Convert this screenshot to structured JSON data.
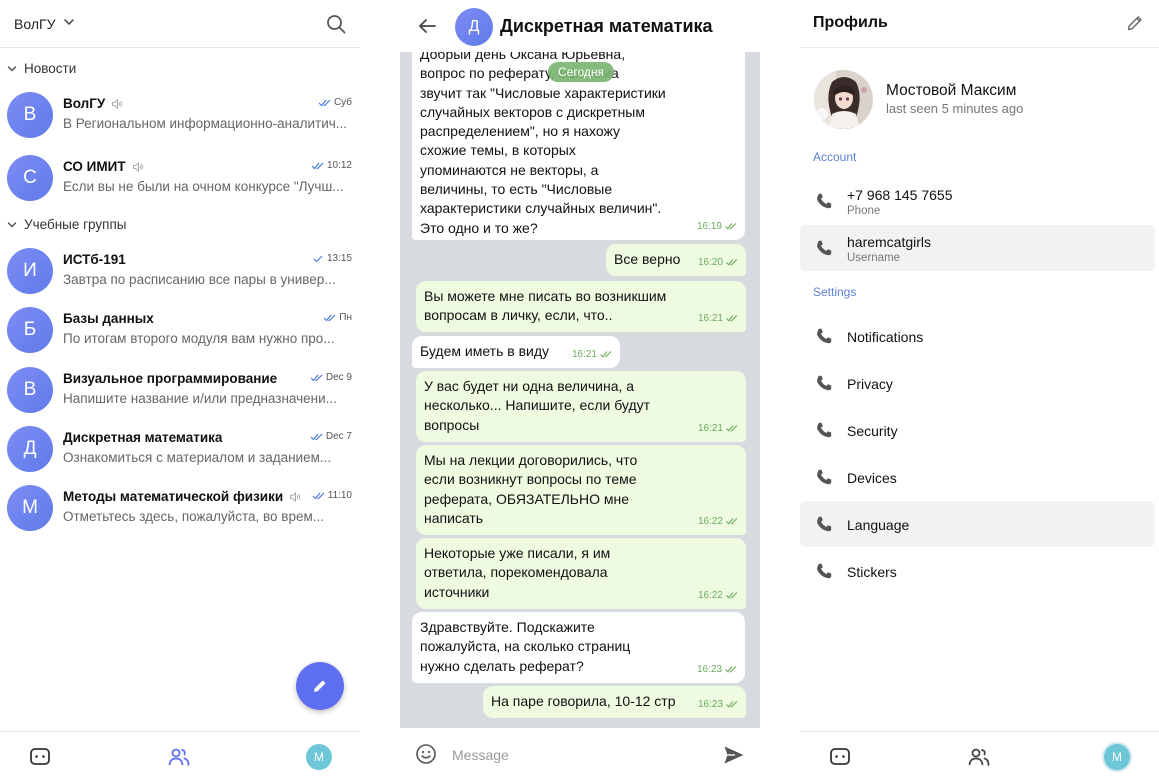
{
  "left": {
    "org_title": "ВолГУ",
    "sections": [
      {
        "label": "Новости"
      },
      {
        "label": "Учебные группы"
      }
    ],
    "chats": [
      {
        "initial": "В",
        "name": "ВолГУ",
        "muted": true,
        "time": "Суб",
        "preview": "В Региональном информационно-аналитич..."
      },
      {
        "initial": "С",
        "name": "СО ИМИТ",
        "muted": true,
        "time": "10:12",
        "preview": "Если вы не были на очном конкурсе \"Лучш..."
      },
      {
        "initial": "И",
        "name": "ИСТб-191",
        "muted": false,
        "time": "13:15",
        "preview": "Завтра по расписанию все пары в универ..."
      },
      {
        "initial": "Б",
        "name": "Базы данных",
        "muted": false,
        "time": "Пн",
        "preview": "По итогам второго модуля вам нужно про..."
      },
      {
        "initial": "В",
        "name": "Визуальное программирование",
        "muted": false,
        "time": "Dec 9",
        "preview": "Напишите название и/или предназначени..."
      },
      {
        "initial": "Д",
        "name": "Дискретная математика",
        "muted": false,
        "time": "Dec 7",
        "preview": "Ознакомиться с материалом и заданием..."
      },
      {
        "initial": "М",
        "name": "Методы математической физики",
        "muted": true,
        "time": "11:10",
        "preview": "Отметьтесь здесь, пожалуйста, во врем..."
      }
    ],
    "nav_avatar_initial": "M"
  },
  "middle": {
    "chat_initial": "Д",
    "chat_title": "Дискретная математика",
    "date_pill": "Сегодня",
    "messages": [
      {
        "dir": "in",
        "text": "Добрый день Оксана Юрьевна,\nвопрос по реферату, моя тема\nзвучит так \"Числовые характеристики\nслучайных векторов с дискретным\nраспределением\", но я нахожу\nсхожие темы, в которых\nупоминаются не векторы, а\nвеличины, то есть \"Числовые\nхарактеристики случайных величин\".\nЭто одно и то же?",
        "time": "16:19"
      },
      {
        "dir": "out",
        "text": "Все верно",
        "time": "16:20"
      },
      {
        "dir": "out",
        "text": "Вы можете мне писать во возникшим\nвопросам в личку, если, что..",
        "time": "16:21"
      },
      {
        "dir": "in",
        "text": "Будем иметь в виду",
        "time": "16:21"
      },
      {
        "dir": "out",
        "text": "У вас будет ни одна величина, а\nнесколько... Напишите, если будут\nвопросы",
        "time": "16:21"
      },
      {
        "dir": "out",
        "text": "Мы на лекции договорились, что\nесли возникнут вопросы по теме\nреферата, ОБЯЗАТЕЛЬНО мне\nнаписать",
        "time": "16:22"
      },
      {
        "dir": "out",
        "text": "Некоторые уже писали, я им\nответила, порекомендовала\nисточники",
        "time": "16:22"
      },
      {
        "dir": "in",
        "text": "Здравствуйте. Подскажите\nпожалуйста, на сколько страниц\nнужно сделать реферат?",
        "time": "16:23"
      },
      {
        "dir": "out",
        "text": "На паре говорила, 10-12 стр",
        "time": "16:23"
      }
    ],
    "composer_placeholder": "Message"
  },
  "right": {
    "title": "Профиль",
    "name": "Мостовой Максим",
    "status": "last seen 5 minutes ago",
    "account_label": "Account",
    "phone": {
      "value": "+7 968 145 7655",
      "label": "Phone"
    },
    "username": {
      "value": "haremcatgirls",
      "label": "Username"
    },
    "settings_label": "Settings",
    "settings": [
      {
        "label": "Notifications"
      },
      {
        "label": "Privacy"
      },
      {
        "label": "Security"
      },
      {
        "label": "Devices"
      },
      {
        "label": "Language"
      },
      {
        "label": "Stickers"
      }
    ],
    "nav_avatar_initial": "M"
  },
  "colors": {
    "accent": "#5d6ff0",
    "link": "#5a80d6",
    "out_bubble": "#eefbe0",
    "chat_bg": "#d7dbe0",
    "check": "#6cab5f"
  }
}
